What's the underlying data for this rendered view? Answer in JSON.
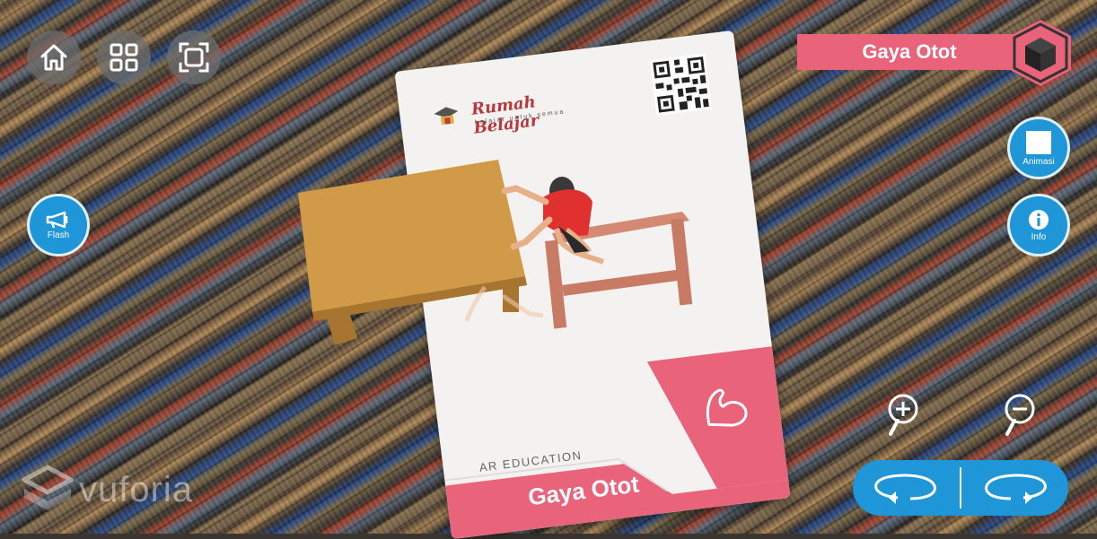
{
  "top_left_buttons": [
    {
      "name": "home",
      "icon": "home-icon"
    },
    {
      "name": "menu",
      "icon": "grid-icon"
    },
    {
      "name": "fullscreen",
      "icon": "frame-icon"
    }
  ],
  "flash": {
    "label": "Flash",
    "icon": "megaphone-icon"
  },
  "title": {
    "text": "Gaya Otot",
    "icon": "cube-icon",
    "color": "#e9637a"
  },
  "animasi": {
    "label": "Animasi",
    "icon": "square-icon"
  },
  "info": {
    "label": "Info",
    "icon": "info-icon"
  },
  "zoom": {
    "in_icon": "zoom-in-icon",
    "out_icon": "zoom-out-icon"
  },
  "rotate": {
    "left_icon": "rotate-left-icon",
    "right_icon": "rotate-right-icon",
    "color": "#1e96d8"
  },
  "watermark": {
    "text": "vuforia"
  },
  "card": {
    "brand": "Rumah Belajar",
    "tagline": "belajar untuk semua",
    "category": "AR EDUCATION",
    "name": "Gaya Otot",
    "icon": "muscle-arm-icon",
    "qr_icon": "qr-code-icon"
  }
}
